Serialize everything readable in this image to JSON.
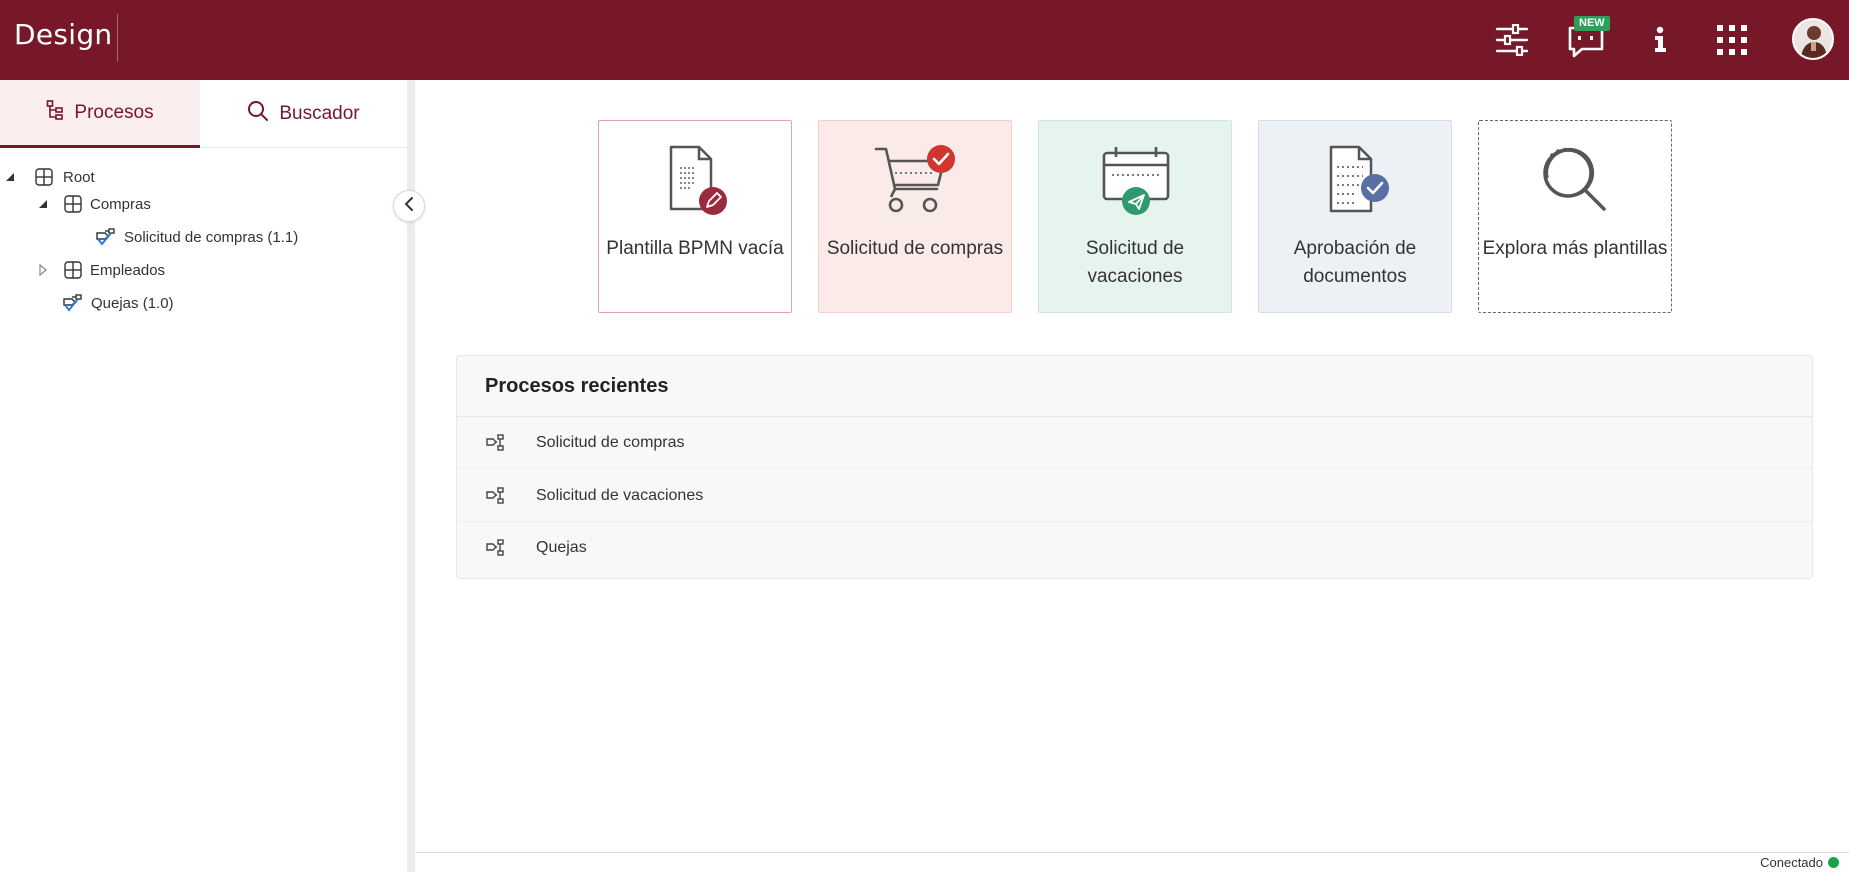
{
  "app": {
    "brand": "Design"
  },
  "topbar": {
    "icons": [
      "sliders-icon",
      "chat-icon",
      "info-icon",
      "apps-grid-icon"
    ],
    "new_badge": "NEW",
    "bg_color": "#771828"
  },
  "sidebar": {
    "tabs": [
      {
        "label": "Procesos",
        "icon": "hierarchy-icon",
        "active": true
      },
      {
        "label": "Buscador",
        "icon": "search-icon",
        "active": false
      }
    ],
    "tree": [
      {
        "label": "Root",
        "icon": "folder-grid-icon",
        "expanded": true
      },
      {
        "label": "Compras",
        "icon": "folder-grid-icon",
        "expanded": true
      },
      {
        "label": "Solicitud de compras (1.1)",
        "icon": "process-icon"
      },
      {
        "label": "Empleados",
        "icon": "folder-grid-icon",
        "expanded": false
      },
      {
        "label": "Quejas (1.0)",
        "icon": "process-icon"
      }
    ]
  },
  "templates": [
    {
      "label": "Plantilla BPMN vacía",
      "icon": "blank-document-icon",
      "badge_color": "#9a2a3e"
    },
    {
      "label": "Solicitud de compras",
      "icon": "shopping-cart-icon",
      "badge_color": "#d0362d"
    },
    {
      "label": "Solicitud de vacaciones",
      "icon": "calendar-icon",
      "badge_color": "#2f9a6b"
    },
    {
      "label": "Aprobación de documentos",
      "icon": "document-check-icon",
      "badge_color": "#5a6fa3"
    },
    {
      "label": "Explora más plantillas",
      "icon": "search-icon"
    }
  ],
  "recent": {
    "title": "Procesos recientes",
    "items": [
      "Solicitud de compras",
      "Solicitud de vacaciones",
      "Quejas"
    ]
  },
  "status": {
    "label": "Conectado",
    "color": "#19a34a"
  }
}
